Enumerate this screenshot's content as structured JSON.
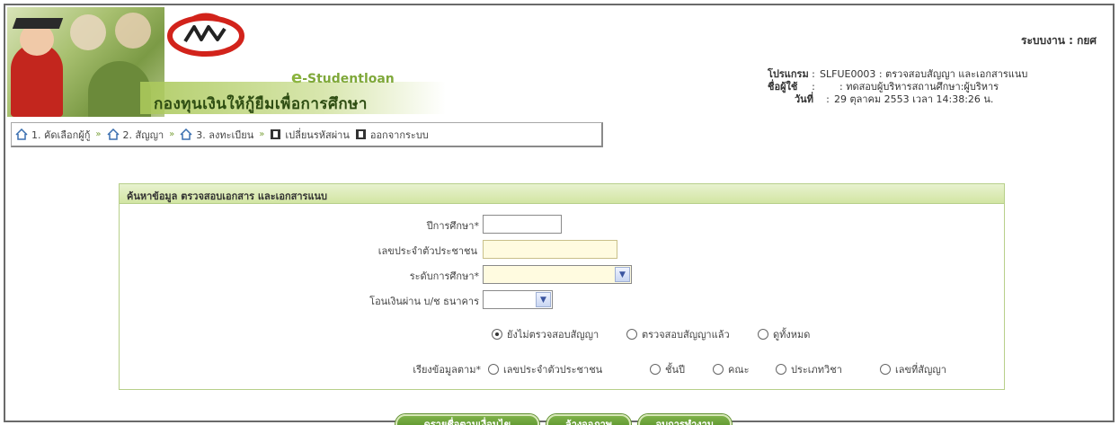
{
  "header": {
    "brand_small": "-Studentloan",
    "brand_e": "e",
    "fund_name": "กองทุนเงินให้กู้ยืมเพื่อการศึกษา",
    "system_label": "ระบบงาน : กยศ",
    "program_key": "โปรแกรม",
    "program_value": "SLFUE0003 : ตรวจสอบสัญญา และเอกสารแนบ",
    "user_key": "ชื่อผู้ใช้",
    "user_value": ": ทดสอบผู้บริหารสถานศึกษา:ผู้บริหาร",
    "date_key": "วันที่",
    "date_value": "29 ตุลาคม 2553 เวลา 14:38:26 น."
  },
  "nav": {
    "item1": "1. คัดเลือกผู้กู้",
    "item2": "2. สัญญา",
    "item3": "3. ลงทะเบียน",
    "item4": "เปลี่ยนรหัสผ่าน",
    "item5": "ออกจากระบบ"
  },
  "panel": {
    "title": "ค้นหาข้อมูล ตรวจสอบเอกสาร และเอกสารแนบ",
    "academic_year_label": "ปีการศึกษา*",
    "id_label": "เลขประจำตัวประชาชน",
    "level_label": "ระดับการศึกษา*",
    "transfer_label": "โอนเงินผ่าน บ/ช ธนาคาร",
    "status_options": [
      "ยังไม่ตรวจสอบสัญญา",
      "ตรวจสอบสัญญาแล้ว",
      "ดูทั้งหมด"
    ],
    "sort_label": "เรียงข้อมูลตาม*",
    "sort_options": [
      "เลขประจำตัวประชาชน",
      "ชั้นปี",
      "คณะ",
      "ประเภทวิชา",
      "เลขที่สัญญา"
    ]
  },
  "buttons": {
    "search": "ดูรายชื่อตามเงื่อนไข",
    "clear": "ล้างจอภาพ",
    "finish": "จบการทำงาน"
  },
  "colors": {
    "accent_green": "#4f8a22",
    "panel_header": "#d2e5a3",
    "logo_red": "#d2231b"
  }
}
